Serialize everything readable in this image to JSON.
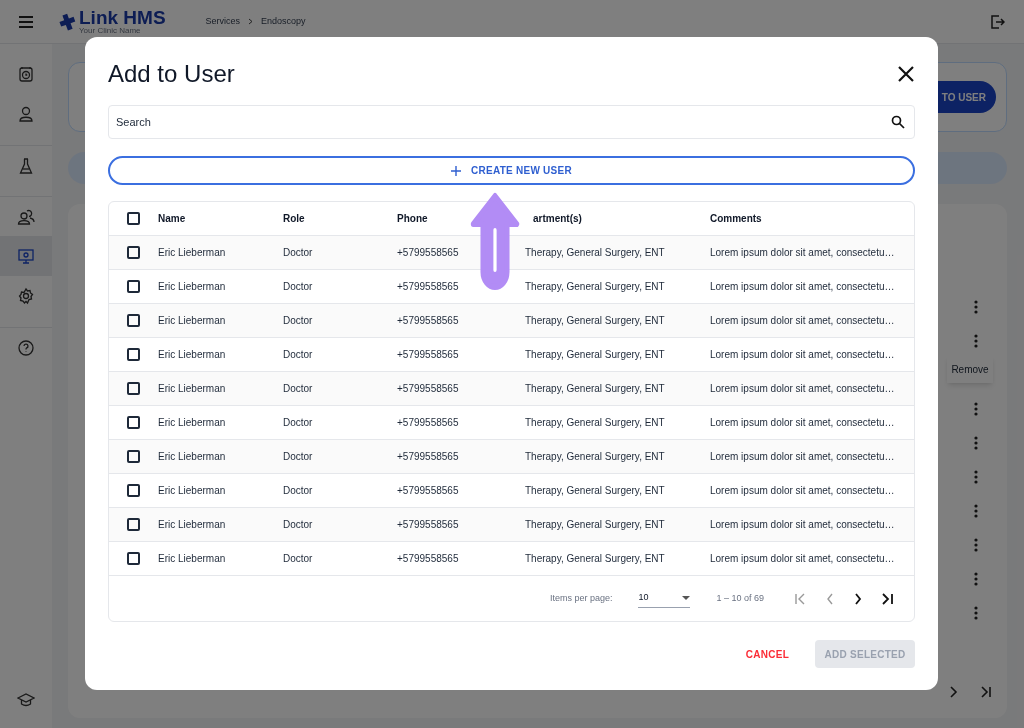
{
  "app": {
    "logo": "Link HMS",
    "clinic": "Your Clinic Name",
    "breadcrumb": [
      "Services",
      "Endoscopy"
    ],
    "sidebar": [
      {
        "kind": "calendar",
        "selected": false
      },
      {
        "kind": "person",
        "selected": false
      },
      {
        "kind": "flask",
        "selected": false
      },
      {
        "kind": "people",
        "selected": false
      },
      {
        "kind": "monitor",
        "selected": true
      },
      {
        "kind": "gear",
        "selected": false
      },
      {
        "kind": "help",
        "selected": false
      },
      {
        "kind": "graduation",
        "selected": false
      }
    ],
    "background_button": "TO USER",
    "context_menu_item": "Remove"
  },
  "dialog": {
    "title": "Add to User",
    "search": {
      "placeholder": "Search"
    },
    "create_button": "CREATE NEW USER",
    "columns": [
      "Name",
      "Role",
      "Phone",
      "artment(s)",
      "Comments"
    ],
    "select_all_checked": false,
    "rows": [
      {
        "checked": false,
        "cells": [
          "Eric Lieberman",
          "Doctor",
          "+5799558565",
          "Therapy, General Surgery, ENT",
          "Lorem ipsum dolor sit amet, consectetu…"
        ]
      },
      {
        "checked": false,
        "cells": [
          "Eric Lieberman",
          "Doctor",
          "+5799558565",
          "Therapy, General Surgery, ENT",
          "Lorem ipsum dolor sit amet, consectetu…"
        ]
      },
      {
        "checked": false,
        "cells": [
          "Eric Lieberman",
          "Doctor",
          "+5799558565",
          "Therapy, General Surgery, ENT",
          "Lorem ipsum dolor sit amet, consectetu…"
        ]
      },
      {
        "checked": false,
        "cells": [
          "Eric Lieberman",
          "Doctor",
          "+5799558565",
          "Therapy, General Surgery, ENT",
          "Lorem ipsum dolor sit amet, consectetu…"
        ]
      },
      {
        "checked": false,
        "cells": [
          "Eric Lieberman",
          "Doctor",
          "+5799558565",
          "Therapy, General Surgery, ENT",
          "Lorem ipsum dolor sit amet, consectetu…"
        ]
      },
      {
        "checked": false,
        "cells": [
          "Eric Lieberman",
          "Doctor",
          "+5799558565",
          "Therapy, General Surgery, ENT",
          "Lorem ipsum dolor sit amet, consectetu…"
        ]
      },
      {
        "checked": false,
        "cells": [
          "Eric Lieberman",
          "Doctor",
          "+5799558565",
          "Therapy, General Surgery, ENT",
          "Lorem ipsum dolor sit amet, consectetu…"
        ]
      },
      {
        "checked": false,
        "cells": [
          "Eric Lieberman",
          "Doctor",
          "+5799558565",
          "Therapy, General Surgery, ENT",
          "Lorem ipsum dolor sit amet, consectetu…"
        ]
      },
      {
        "checked": false,
        "cells": [
          "Eric Lieberman",
          "Doctor",
          "+5799558565",
          "Therapy, General Surgery, ENT",
          "Lorem ipsum dolor sit amet, consectetu…"
        ]
      },
      {
        "checked": false,
        "cells": [
          "Eric Lieberman",
          "Doctor",
          "+5799558565",
          "Therapy, General Surgery, ENT",
          "Lorem ipsum dolor sit amet, consectetu…"
        ]
      }
    ],
    "pagination": {
      "label": "Items per page:",
      "per_page": "10",
      "range": "1 – 10 of 69"
    },
    "cancel": "CANCEL",
    "confirm": {
      "label": "ADD SELECTED",
      "disabled": true
    }
  }
}
